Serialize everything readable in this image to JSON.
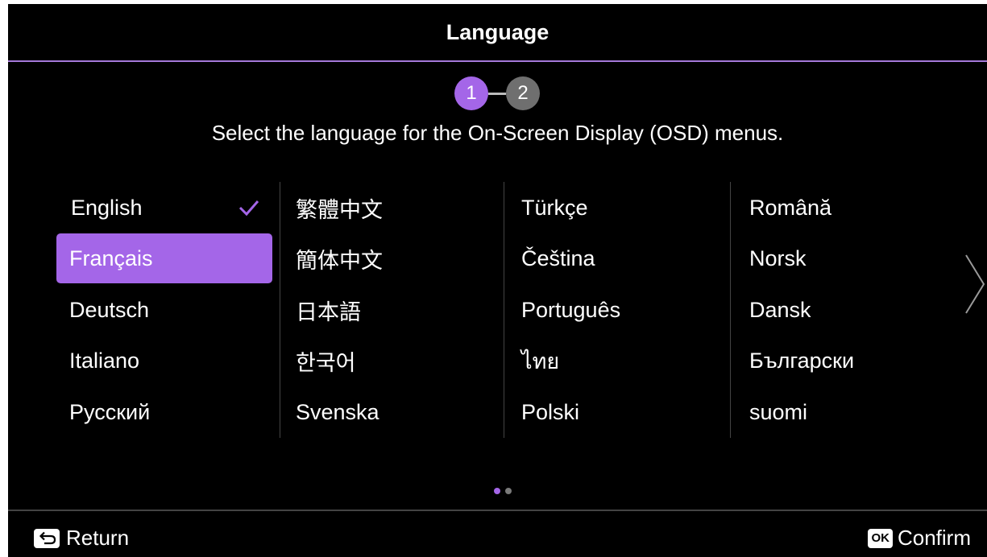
{
  "header": {
    "title": "Language"
  },
  "stepper": {
    "steps": [
      "1",
      "2"
    ],
    "current_step": 1
  },
  "instruction": "Select the language for the On-Screen Display (OSD) menus.",
  "languages": {
    "columns": [
      [
        "English",
        "Français",
        "Deutsch",
        "Italiano",
        "Русский"
      ],
      [
        "繁體中文",
        "簡体中文",
        "日本語",
        "한국어",
        "Svenska"
      ],
      [
        "Türkçe",
        "Čeština",
        "Português",
        "ไทย",
        "Polski"
      ],
      [
        "Română",
        "Norsk",
        "Dansk",
        "Български",
        "suomi"
      ]
    ],
    "checked": "English",
    "highlighted": "Français"
  },
  "pagination": {
    "current_page": 1,
    "total_pages": 2
  },
  "footer": {
    "return_label": "Return",
    "ok_key_label": "OK",
    "confirm_label": "Confirm"
  },
  "colors": {
    "accent": "#a466e8",
    "background": "#000000",
    "divider": "#444444",
    "inactive_step": "#6f6f6f"
  },
  "icons": {
    "check": "check-icon",
    "next": "chevron-right-icon",
    "return": "return-icon",
    "ok": "ok-key-icon"
  }
}
